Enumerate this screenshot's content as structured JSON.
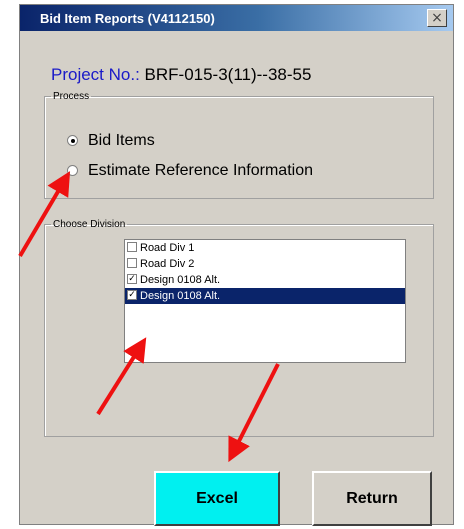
{
  "window": {
    "title": "Bid Item Reports (V4112150)",
    "close_label": "×"
  },
  "project": {
    "label": "Project No.:",
    "value": " BRF-015-3(11)--38-55"
  },
  "process": {
    "legend": "Process",
    "options": [
      {
        "label": "Bid Items",
        "checked": true
      },
      {
        "label": "Estimate Reference Information",
        "checked": false
      }
    ]
  },
  "division": {
    "legend": "Choose Division",
    "items": [
      {
        "label": "Road Div 1",
        "checked": false,
        "selected": false
      },
      {
        "label": "Road Div 2",
        "checked": false,
        "selected": false
      },
      {
        "label": "Design 0108 Alt.",
        "checked": true,
        "selected": false
      },
      {
        "label": "Design 0108 Alt.",
        "checked": true,
        "selected": true
      }
    ]
  },
  "buttons": {
    "excel": "Excel",
    "return": "Return"
  },
  "colors": {
    "arrow": "#ff0000",
    "excel_bg": "#00f0f0",
    "selection": "#0a246a"
  }
}
